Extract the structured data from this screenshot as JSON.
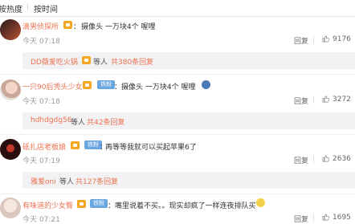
{
  "tabs": {
    "hot": "按热度",
    "separator": "|",
    "time": "按时间"
  },
  "comments": [
    {
      "user": "滴男侦探所",
      "text": "摄像头 一万块4个 喔哩",
      "time": "今天 07:18",
      "reply": "回复",
      "likes": "9176",
      "sub": {
        "user": "DD薇爱吃火锅",
        "etc": "等人",
        "total": "共380条回复"
      }
    },
    {
      "user": "一只90后秃头少女",
      "fan_badge": "铁粉",
      "text": "摄像头 一万块4个 喔哩",
      "time": "今天 07:18",
      "reply": "回复",
      "likes": "3272",
      "sub": {
        "user": "hdhdgdg56",
        "etc": "等人",
        "total": "共42条回复"
      }
    },
    {
      "user": "砥扎店老板娘",
      "fan_badge": "铁粉",
      "text": "再等等我就可以买起苹果6了",
      "time": "今天 07:19",
      "reply": "回复",
      "likes": "2636",
      "sub": {
        "user": "雅爱oni",
        "etc": "等人",
        "total": "共127条回复"
      }
    },
    {
      "user": "有味道的少女臀",
      "fan_badge": "铁粉",
      "text": "嘴里说着不买。。现实却疯了一样连夜排队买",
      "time": "今天 07:21",
      "reply": "回复",
      "likes": "1695"
    }
  ],
  "colors": {
    "username": "#eb7350",
    "fan_badge": "#6aa6e0",
    "medal": "#f5a623",
    "subbox": "#f2f2f5"
  },
  "icons": {
    "like": "thumb-up-icon",
    "medal": "medal-icon",
    "emoji": "smiley-emoji-icon"
  }
}
